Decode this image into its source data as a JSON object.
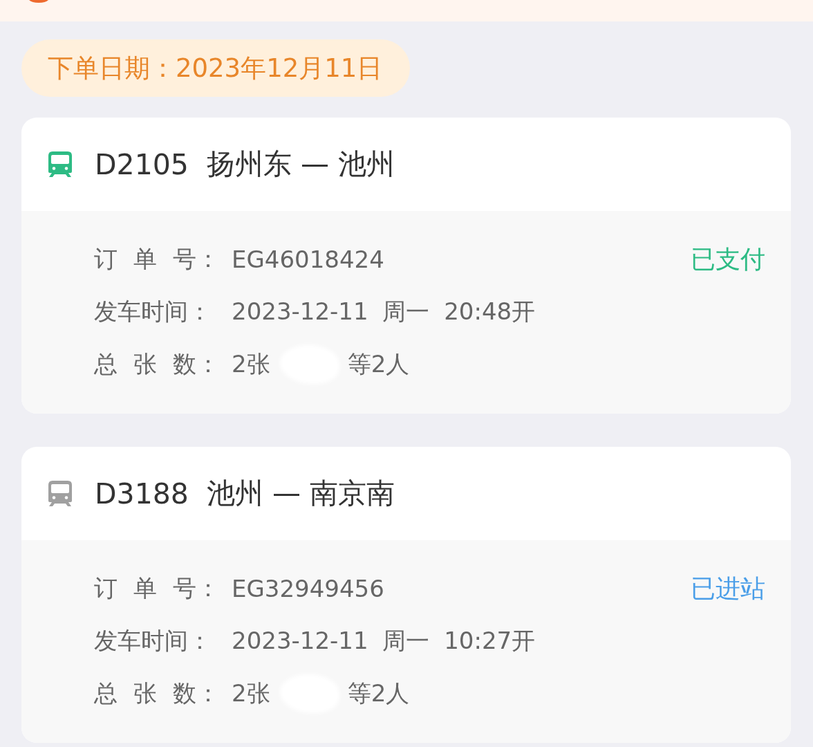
{
  "order_date": "下单日期：2023年12月11日",
  "orders": [
    {
      "train": "D2105",
      "route": "扬州东 — 池州",
      "color": "#2dbb84",
      "status": {
        "text": "已支付",
        "color": "#2dbb84"
      },
      "fields": [
        {
          "label": "订 单 号：",
          "value": "EG46018424"
        },
        {
          "label": "发车时间：",
          "value": "2023-12-11 周一 20:48开"
        },
        {
          "label": "总 张 数：",
          "value": "2张",
          "name_hidden": true,
          "note": "等2人"
        }
      ]
    },
    {
      "train": "D3188",
      "route": "池州 — 南京南",
      "color": "#a0a0a0",
      "status": {
        "text": "已进站",
        "color": "#4a9ee8"
      },
      "fields": [
        {
          "label": "订 单 号：",
          "value": "EG32949456"
        },
        {
          "label": "发车时间：",
          "value": "2023-12-11 周一 10:27开"
        },
        {
          "label": "总 张 数：",
          "value": "2张",
          "name_hidden": true,
          "note": "等2人"
        }
      ]
    }
  ]
}
